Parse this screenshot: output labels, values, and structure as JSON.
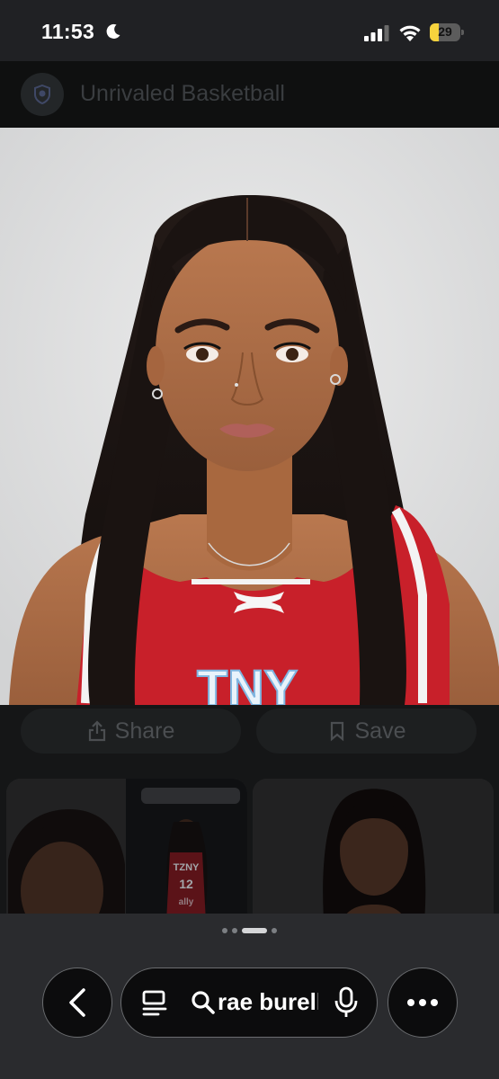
{
  "status_bar": {
    "time": "11:53",
    "battery_level": "29",
    "battery_fraction": 0.29,
    "icons": [
      "moon-icon",
      "signal-icon",
      "wifi-icon",
      "battery-icon"
    ]
  },
  "source": {
    "name": "Unrivaled Basketball",
    "logo_icon": "unrivaled-logo-icon"
  },
  "main_image": {
    "jersey_text": "TNY"
  },
  "actions": {
    "share_label": "Share",
    "save_label": "Save"
  },
  "related": {
    "thumb_jersey_text_1": "TZNY",
    "thumb_jersey_number": "12",
    "thumb_jersey_text_2": "ally"
  },
  "pagination": {
    "total": 4,
    "active_index": 2
  },
  "bottom_bar": {
    "search_query": "rae burell",
    "icons": [
      "back-arrow-icon",
      "lens-icon",
      "search-icon",
      "mic-icon",
      "more-dots-icon"
    ]
  },
  "colors": {
    "background": "#202124",
    "battery_fill": "#f6d33d",
    "jersey_red": "#c8202a"
  }
}
